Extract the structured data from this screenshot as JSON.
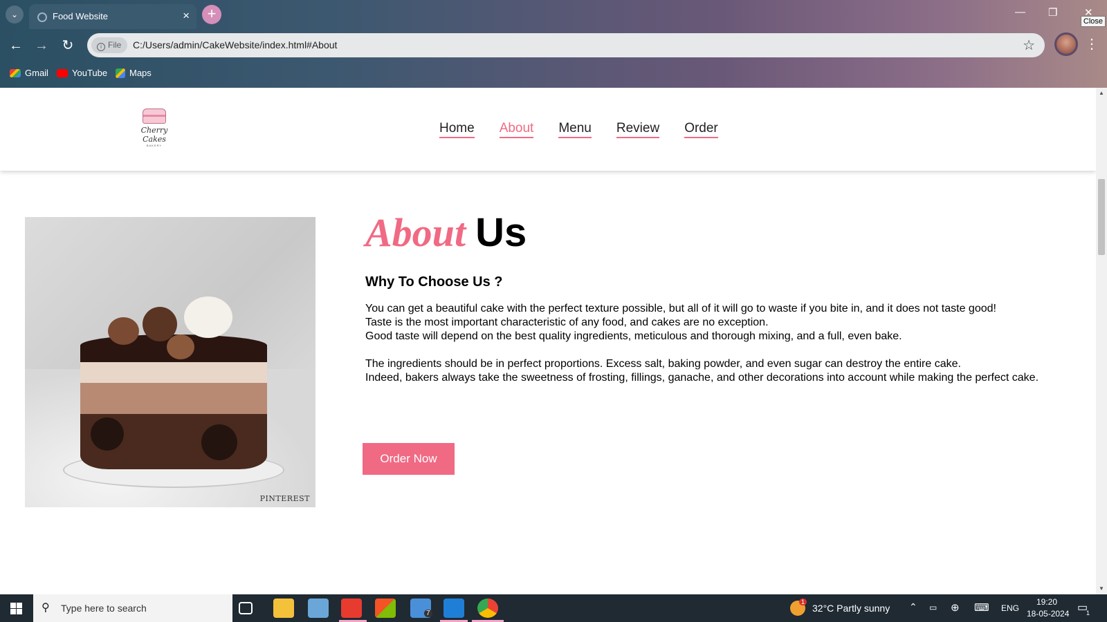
{
  "browser": {
    "tab_title": "Food Website",
    "close_tooltip": "Close",
    "file_chip": "File",
    "url": "C:/Users/admin/CakeWebsite/index.html#About",
    "bookmarks": [
      "Gmail",
      "YouTube",
      "Maps"
    ]
  },
  "site": {
    "logo_text": "Cherry Cakes",
    "logo_sub": "BAKERY",
    "nav": [
      "Home",
      "About",
      "Menu",
      "Review",
      "Order"
    ],
    "active_nav": "About",
    "image_caption": "PINTEREST",
    "title_part1": "About",
    "title_part2": "Us",
    "subtitle": "Why To Choose Us ?",
    "paragraph1": [
      "You can get a beautiful cake with the perfect texture possible, but all of it will go to waste if you bite in, and it does not taste good!",
      "Taste is the most important characteristic of any food, and cakes are no exception.",
      "Good taste will depend on the best quality ingredients, meticulous and thorough mixing, and a full, even bake."
    ],
    "paragraph2": [
      "The ingredients should be in perfect proportions. Excess salt, baking powder, and even sugar can destroy the entire cake.",
      "Indeed, bakers always take the sweetness of frosting, fillings, ganache, and other decorations into account while making the perfect cake."
    ],
    "order_button": "Order Now",
    "accent_color": "#f06a84"
  },
  "taskbar": {
    "search_placeholder": "Type here to search",
    "mail_badge": "7",
    "weather": "32°C  Partly sunny",
    "weather_badge": "1",
    "language": "ENG",
    "time": "19:20",
    "date": "18-05-2024",
    "notification_count": "1"
  }
}
